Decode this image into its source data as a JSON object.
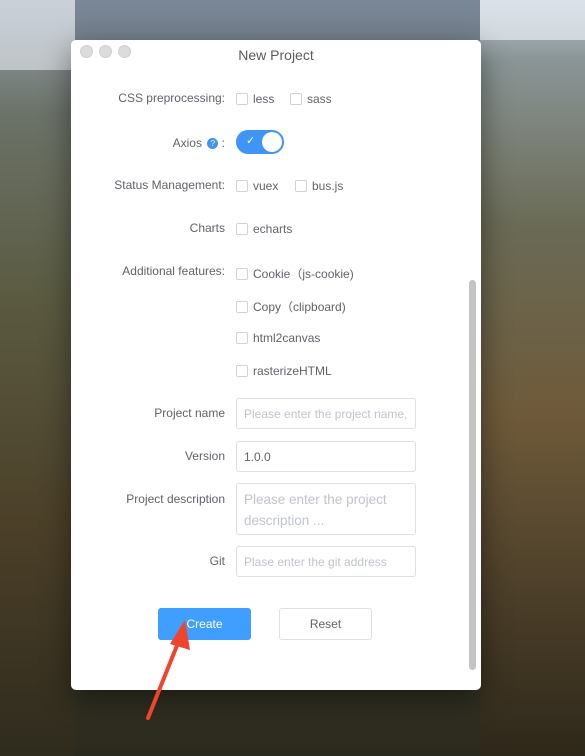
{
  "window": {
    "title": "New Project"
  },
  "form": {
    "css": {
      "label": "CSS preprocessing:",
      "options": [
        "less",
        "sass"
      ]
    },
    "axios": {
      "label": "Axios",
      "suffix": ":",
      "info": "?",
      "enabled": true
    },
    "state": {
      "label": "Status Management:",
      "options": [
        "vuex",
        "bus.js"
      ]
    },
    "charts": {
      "label": "Charts",
      "options": [
        "echarts"
      ]
    },
    "features": {
      "label": "Additional features:",
      "options": [
        "Cookie（js-cookie)",
        "Copy（clipboard)",
        "html2canvas",
        "rasterizeHTML"
      ]
    },
    "project_name": {
      "label": "Project name",
      "placeholder": "Please enter the project name,",
      "value": ""
    },
    "version": {
      "label": "Version",
      "value": "1.0.0"
    },
    "description": {
      "label": "Project description",
      "placeholder": "Please enter the project description ..."
    },
    "git": {
      "label": "Git",
      "placeholder": "Plase enter the git address"
    }
  },
  "actions": {
    "create": "Create",
    "reset": "Reset"
  },
  "colors": {
    "primary": "#409eff",
    "annotation_arrow": "#f0442c"
  }
}
